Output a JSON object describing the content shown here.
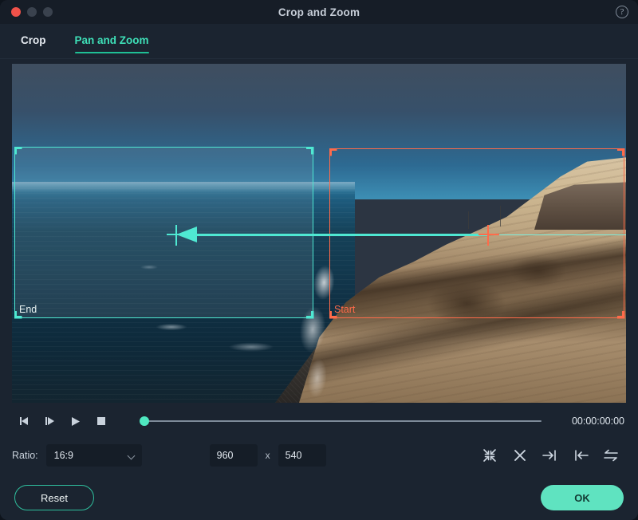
{
  "window": {
    "title": "Crop and Zoom",
    "help_icon": "help-circle-icon",
    "traffic": {
      "close": "close-button",
      "minimize": "minimize-button",
      "maximize": "maximize-button"
    }
  },
  "tabs": [
    {
      "label": "Crop",
      "active": false
    },
    {
      "label": "Pan and Zoom",
      "active": true
    }
  ],
  "preview": {
    "start_rect": {
      "label": "Start",
      "color": "#ff6b4a"
    },
    "end_rect": {
      "label": "End",
      "color": "#4fe8d2"
    },
    "motion_arrow": "pan-direction-arrow"
  },
  "transport": {
    "prev_frame": "previous-frame-icon",
    "next_frame": "next-frame-icon",
    "play": "play-icon",
    "stop": "stop-icon",
    "timecode": "00:00:00:00",
    "progress_percent": 0
  },
  "options": {
    "ratio_label": "Ratio:",
    "ratio_value": "16:9",
    "width_value": "960",
    "separator": "x",
    "height_value": "540",
    "tools": [
      {
        "name": "shrink-inward-icon"
      },
      {
        "name": "close-cross-icon"
      },
      {
        "name": "align-right-icon"
      },
      {
        "name": "align-left-icon"
      },
      {
        "name": "swap-start-end-icon"
      }
    ]
  },
  "footer": {
    "reset_label": "Reset",
    "ok_label": "OK"
  },
  "colors": {
    "accent": "#5fe3c0",
    "start_marker": "#ff6b4a",
    "end_marker": "#4fe8d2",
    "window_bg": "#1b2430"
  }
}
